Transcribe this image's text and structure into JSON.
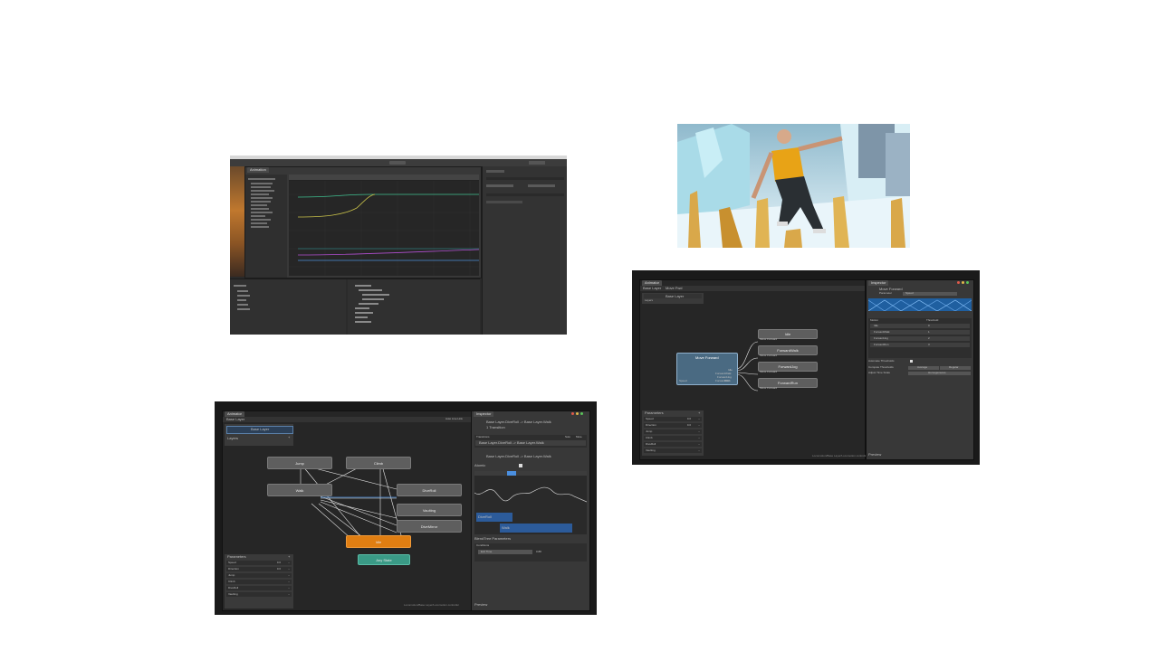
{
  "animation_window": {
    "title": "Animation",
    "toolbar_items": [
      "Hierarchy",
      "Scene",
      "Animation",
      "Inspector"
    ],
    "curve_colors": [
      "#3fbf8f",
      "#c9c24a",
      "#b24fd1",
      "#4c8fd6"
    ]
  },
  "render_image": {
    "description_icon": "character-render-icon",
    "colors": {
      "sky": "#bfe3f0",
      "shirt": "#e8a316",
      "pants": "#2a2f33",
      "pillars": "#d9a84a"
    }
  },
  "animator_left": {
    "tab_animator": "Animator",
    "tab_inspector": "Inspector",
    "layer_breadcrumb": "Base Layer",
    "layer_item": "Base Layer",
    "layers_label": "Layers",
    "auto_live_link": "Auto Live Link",
    "nodes": {
      "jump": "Jump",
      "climb": "Climb",
      "walk": "Walk",
      "dive_roll": "DiveRoll",
      "vaulting": "Vaulting",
      "dive_mirror": "DiveMirror",
      "idle": "Idle",
      "any_state": "Any State"
    },
    "parameters_title": "Parameters",
    "parameters": [
      {
        "name": "Speed",
        "value": "0.0"
      },
      {
        "name": "Direction",
        "value": "0.0"
      },
      {
        "name": "Jump",
        "value": ""
      },
      {
        "name": "Climb",
        "value": ""
      },
      {
        "name": "DiveRoll",
        "value": ""
      },
      {
        "name": "Vaulting",
        "value": ""
      }
    ],
    "footer_path": "Locomotion/Base Layer/Locomotion.controller",
    "inspector": {
      "transition_title": "Base Layer.DiveRoll -> Base Layer.Walk",
      "transition_count": "1 Transition",
      "transitions_label": "Transitions",
      "solo_label": "Solo",
      "mute_label": "Mute",
      "transition_row": "Base Layer.DiveRoll -> Base Layer.Walk",
      "subtitle": "Base Layer.DiveRoll -> Base Layer.Walk",
      "atomic_label": "Atomic",
      "preview_label": "Preview",
      "state_a": "DiveRoll",
      "state_b": "Walk",
      "blend_params_label": "BlendTree Parameters",
      "conditions_label": "Conditions",
      "condition_param": "Exit Time",
      "condition_value": "0.88",
      "footer": "Preview"
    }
  },
  "animator_right": {
    "tab_animator": "Animator",
    "breadcrumb_1": "Base Layer",
    "breadcrumb_2": "Move Fwd",
    "layer_item": "Base Layer",
    "layers_label": "Layers",
    "blend_node": "Move Forward",
    "blend_ports": [
      "Idle",
      "ForwardWalk",
      "ForwardJog",
      "ForwardRun"
    ],
    "speed_param": "Speed",
    "speed_value": "0.00",
    "outputs": [
      {
        "name": "Idle",
        "sub": "Move Forward"
      },
      {
        "name": "ForwardWalk",
        "sub": "Move Forward"
      },
      {
        "name": "ForwardJog",
        "sub": "Move Forward"
      },
      {
        "name": "ForwardRun",
        "sub": "Move Forward"
      }
    ],
    "parameters_title": "Parameters",
    "parameters": [
      {
        "name": "Speed",
        "value": "0.0"
      },
      {
        "name": "Direction",
        "value": "0.0"
      },
      {
        "name": "Jump",
        "value": ""
      },
      {
        "name": "Climb",
        "value": ""
      },
      {
        "name": "DiveRoll",
        "value": ""
      },
      {
        "name": "Vaulting",
        "value": ""
      }
    ],
    "footer_path": "Locomotion/Base Layer/Locomotion.controller",
    "inspector": {
      "tab": "Inspector",
      "title": "Move Forward",
      "param_label": "Parameter",
      "param_value": "Speed",
      "motion_header": "Motion",
      "threshold_header": "Threshold",
      "motions": [
        {
          "name": "Idle",
          "threshold": "0"
        },
        {
          "name": "ForwardWalk",
          "threshold": "1"
        },
        {
          "name": "ForwardJog",
          "threshold": "2"
        },
        {
          "name": "ForwardRun",
          "threshold": "3"
        }
      ],
      "auto_thresholds": "Automate Thresholds",
      "compute_thresholds": "Compute Thresholds",
      "compute_choice_a": "Average",
      "compute_choice_b": "Regular",
      "adjust_time_scale": "Adjust Time Scale",
      "adjust_choice": "Homogeneous",
      "footer": "Preview"
    }
  }
}
